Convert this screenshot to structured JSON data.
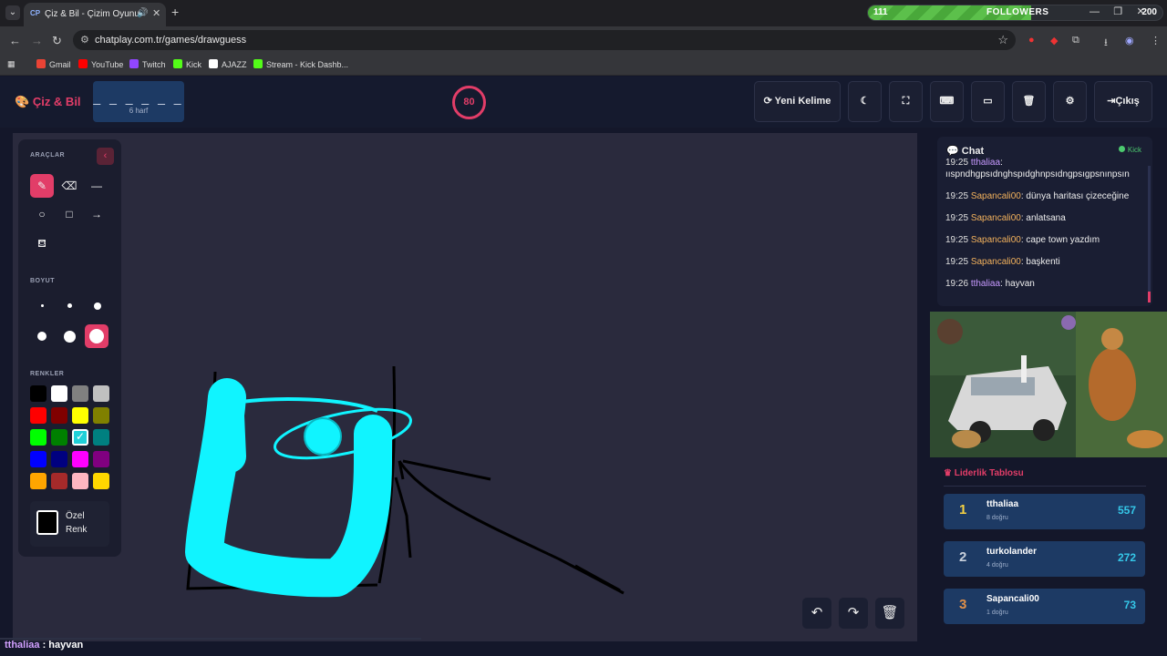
{
  "browser": {
    "tab_title": "Çiz & Bil - Çizim Oyunu",
    "tab_favicon_text": "CP",
    "url": "chatplay.com.tr/games/drawguess",
    "followers": {
      "current": "111",
      "label": "FOLLOWERS",
      "goal": "200",
      "progress": 0.555
    },
    "bookmarks": [
      {
        "label": "Gmail",
        "color": "#ea4335"
      },
      {
        "label": "YouTube",
        "color": "#ff0000"
      },
      {
        "label": "Twitch",
        "color": "#9146ff"
      },
      {
        "label": "Kick",
        "color": "#53fc18"
      },
      {
        "label": "AJAZZ",
        "color": "#ffffff"
      },
      {
        "label": "Stream - Kick Dashb...",
        "color": "#53fc18"
      }
    ]
  },
  "app": {
    "logo": "Çiz & Bil",
    "word_mask": "_ _ _ _ _ _",
    "letter_count": "6 harf",
    "timer": "80",
    "buttons": {
      "new_word": "Yeni Kelime",
      "exit": "Çıkış"
    },
    "accent_color": "#e23d68"
  },
  "tools": {
    "section_tools": "ARAÇLAR",
    "section_size": "BOYUT",
    "section_colors": "RENKLER",
    "custom_color_line1": "Özel",
    "custom_color_line2": "Renk",
    "colors": [
      "#000000",
      "#ffffff",
      "#808080",
      "#c0c0c0",
      "#ff0000",
      "#800000",
      "#ffff00",
      "#808000",
      "#00ff00",
      "#008000",
      "#20d0d8",
      "#008080",
      "#0000ff",
      "#000080",
      "#ff00ff",
      "#800080",
      "#ffa500",
      "#a52a2a",
      "#ffb6c1",
      "#ffd700"
    ],
    "selected_color": "#20d0d8"
  },
  "chat": {
    "title": "Chat",
    "status": "Kick",
    "messages": [
      {
        "time": "19:25",
        "user": "tthaliaa",
        "text": "ıısрndhgpsıdnghspıdghnpsıdngpsıgpsnınpsın",
        "user_class": "u2"
      },
      {
        "time": "19:25",
        "user": "Sapancali00",
        "text": "dünya haritası çizeceğine",
        "user_class": "u1"
      },
      {
        "time": "19:25",
        "user": "Sapancali00",
        "text": "anlatsana",
        "user_class": "u1"
      },
      {
        "time": "19:25",
        "user": "Sapancali00",
        "text": "cape town yazdım",
        "user_class": "u1"
      },
      {
        "time": "19:25",
        "user": "Sapancali00",
        "text": "başkenti",
        "user_class": "u1"
      },
      {
        "time": "19:26",
        "user": "tthaliaa",
        "text": "hayvan",
        "user_class": "u2"
      }
    ]
  },
  "leaderboard": {
    "title": "Liderlik Tablosu",
    "rows": [
      {
        "rank": "1",
        "name": "tthaliaa",
        "correct": "8 doğru",
        "score": "557",
        "rank_color": "#f5d142"
      },
      {
        "rank": "2",
        "name": "turkolander",
        "correct": "4 doğru",
        "score": "272",
        "rank_color": "#c8d0dc"
      },
      {
        "rank": "3",
        "name": "Sapancali00",
        "correct": "1 doğru",
        "score": "73",
        "rank_color": "#e0904a"
      }
    ]
  },
  "overlay": {
    "user": "tthaliaa",
    "separator": " : ",
    "text": "hayvan"
  }
}
